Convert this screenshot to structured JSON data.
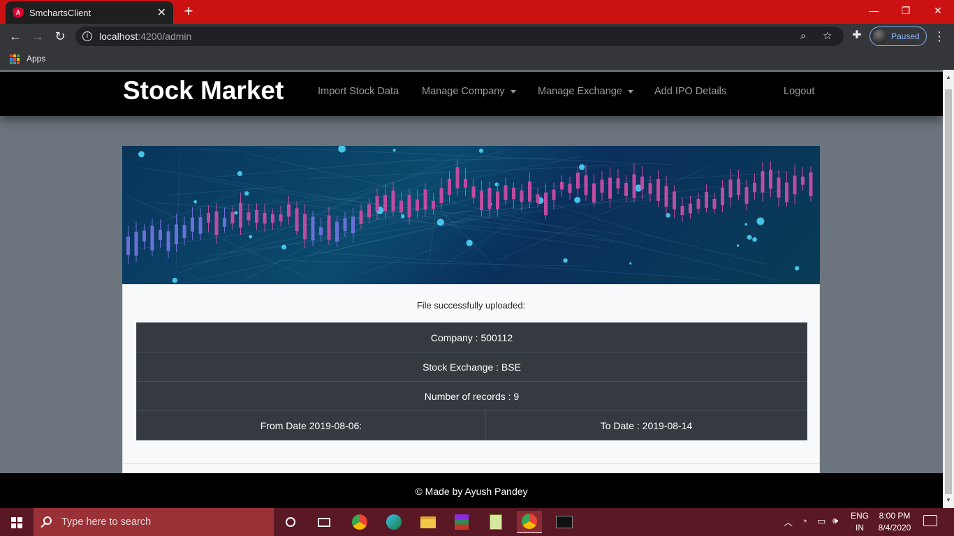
{
  "browser": {
    "tab_title": "SmchartsClient",
    "url_host": "localhost",
    "url_path": ":4200/admin",
    "profile_status": "Paused",
    "bookmarks_apps_label": "Apps"
  },
  "navbar": {
    "brand": "Stock Market",
    "links": [
      "Import Stock Data",
      "Manage Company",
      "Manage Exchange",
      "Add IPO Details",
      "Logout"
    ]
  },
  "upload_result": {
    "message": "File successfully uploaded:",
    "company": "Company : 500112",
    "stock_exchange": "Stock Exchange : BSE",
    "number_of_records": "Number of records : 9",
    "from_date": "From Date 2019-08-06:",
    "to_date": "To Date : 2019-08-14"
  },
  "footer": {
    "text": "© Made by Ayush Pandey"
  },
  "taskbar": {
    "search_placeholder": "Type here to search",
    "language": "ENG",
    "region": "IN",
    "time": "8:00 PM",
    "date": "8/4/2020"
  },
  "colors": {
    "tabstrip": "#cc1111",
    "navbar": "#000000",
    "page_background": "#6c757d",
    "table_dark": "#343a40",
    "taskbar": "#5a1724"
  }
}
